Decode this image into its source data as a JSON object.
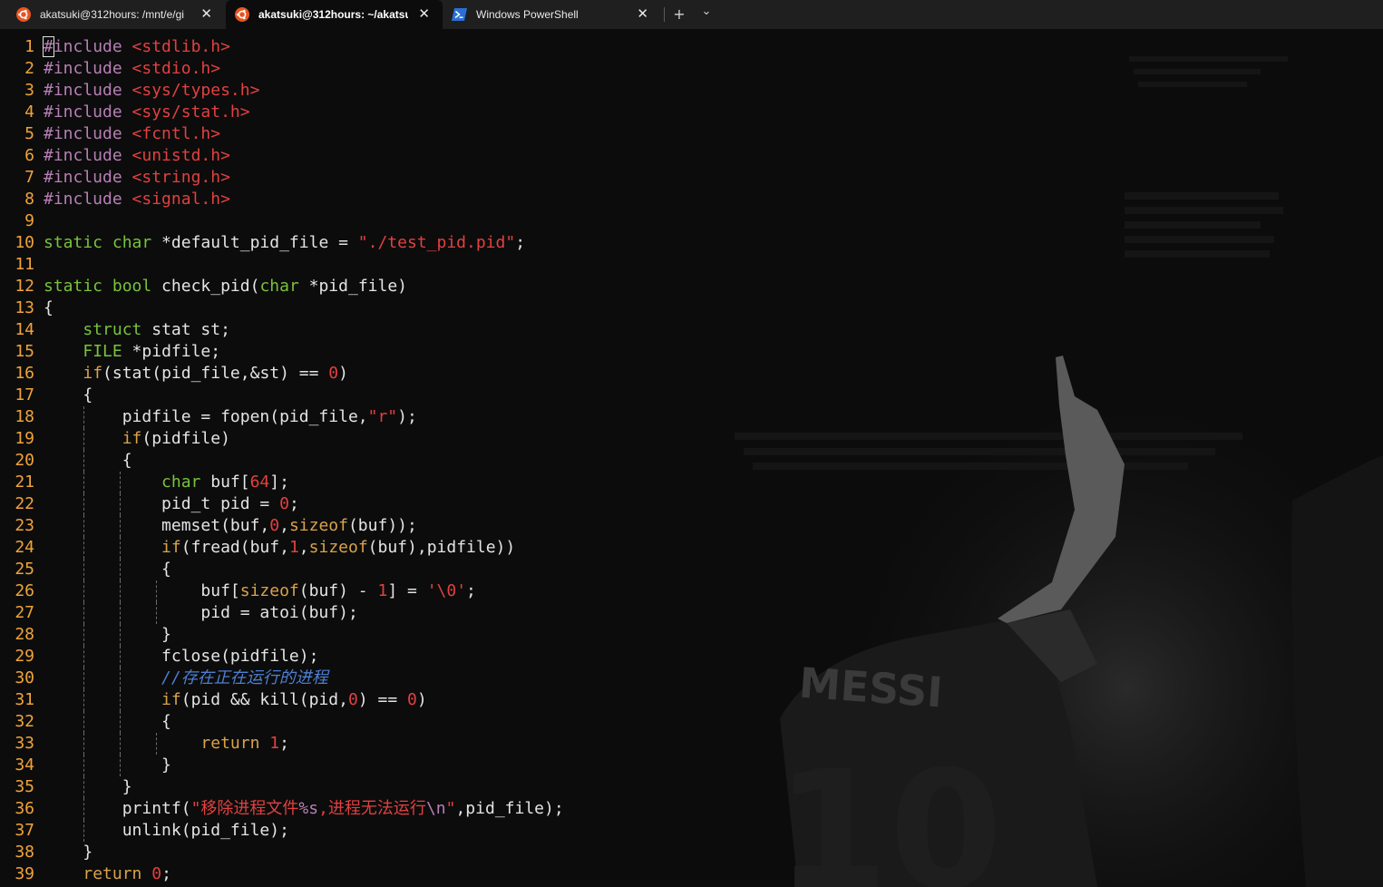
{
  "tabs": [
    {
      "label": "akatsuki@312hours: /mnt/e/gi",
      "icon": "ubuntu-icon",
      "active": false
    },
    {
      "label": "akatsuki@312hours: ~/akatsu",
      "icon": "ubuntu-icon",
      "active": true
    },
    {
      "label": "Windows PowerShell",
      "icon": "powershell-icon",
      "active": false
    }
  ],
  "tabbar": {
    "close_glyph": "✕",
    "new_tab_glyph": "+",
    "dropdown_glyph": "⌄"
  },
  "background": {
    "jersey_name": "MESSI",
    "jersey_number": "10"
  },
  "colors": {
    "keyword": "#d9a34a",
    "type": "#79c23c",
    "preprocessor": "#b77fb5",
    "string": "#e24040",
    "comment": "#4d7fd1",
    "line_number": "#f0a33a"
  },
  "editor": {
    "lines": [
      {
        "n": "1",
        "tokens": [
          [
            "pp",
            "#include "
          ],
          [
            "str",
            "<stdlib.h>"
          ]
        ]
      },
      {
        "n": "2",
        "tokens": [
          [
            "pp",
            "#include "
          ],
          [
            "str",
            "<stdio.h>"
          ]
        ]
      },
      {
        "n": "3",
        "tokens": [
          [
            "pp",
            "#include "
          ],
          [
            "str",
            "<sys/types.h>"
          ]
        ]
      },
      {
        "n": "4",
        "tokens": [
          [
            "pp",
            "#include "
          ],
          [
            "str",
            "<sys/stat.h>"
          ]
        ]
      },
      {
        "n": "5",
        "tokens": [
          [
            "pp",
            "#include "
          ],
          [
            "str",
            "<fcntl.h>"
          ]
        ]
      },
      {
        "n": "6",
        "tokens": [
          [
            "pp",
            "#include "
          ],
          [
            "str",
            "<unistd.h>"
          ]
        ]
      },
      {
        "n": "7",
        "tokens": [
          [
            "pp",
            "#include "
          ],
          [
            "str",
            "<string.h>"
          ]
        ]
      },
      {
        "n": "8",
        "tokens": [
          [
            "pp",
            "#include "
          ],
          [
            "str",
            "<signal.h>"
          ]
        ]
      },
      {
        "n": "9",
        "tokens": []
      },
      {
        "n": "10",
        "tokens": [
          [
            "ty",
            "static char"
          ],
          [
            "",
            " *default_pid_file = "
          ],
          [
            "str",
            "\"./test_pid.pid\""
          ],
          [
            "",
            ";"
          ]
        ]
      },
      {
        "n": "11",
        "tokens": []
      },
      {
        "n": "12",
        "tokens": [
          [
            "ty",
            "static bool"
          ],
          [
            "",
            " check_pid("
          ],
          [
            "ty",
            "char"
          ],
          [
            "",
            " *pid_file)"
          ]
        ]
      },
      {
        "n": "13",
        "tokens": [
          [
            "",
            "{"
          ]
        ]
      },
      {
        "n": "14",
        "tokens": [
          [
            "",
            "    "
          ],
          [
            "ty",
            "struct"
          ],
          [
            "",
            " stat st;"
          ]
        ]
      },
      {
        "n": "15",
        "tokens": [
          [
            "",
            "    "
          ],
          [
            "ty",
            "FILE"
          ],
          [
            "",
            " *pidfile;"
          ]
        ]
      },
      {
        "n": "16",
        "tokens": [
          [
            "",
            "    "
          ],
          [
            "kw",
            "if"
          ],
          [
            "",
            "(stat(pid_file,&st) == "
          ],
          [
            "num",
            "0"
          ],
          [
            "",
            ")"
          ]
        ]
      },
      {
        "n": "17",
        "tokens": [
          [
            "",
            "    {"
          ]
        ]
      },
      {
        "n": "18",
        "tokens": [
          [
            "",
            "        pidfile = fopen(pid_file,"
          ],
          [
            "str",
            "\"r\""
          ],
          [
            "",
            ");"
          ]
        ]
      },
      {
        "n": "19",
        "tokens": [
          [
            "",
            "        "
          ],
          [
            "kw",
            "if"
          ],
          [
            "",
            "(pidfile)"
          ]
        ]
      },
      {
        "n": "20",
        "tokens": [
          [
            "",
            "        {"
          ]
        ]
      },
      {
        "n": "21",
        "tokens": [
          [
            "",
            "            "
          ],
          [
            "ty",
            "char"
          ],
          [
            "",
            " buf["
          ],
          [
            "num",
            "64"
          ],
          [
            "",
            "];"
          ]
        ]
      },
      {
        "n": "22",
        "tokens": [
          [
            "",
            "            pid_t pid = "
          ],
          [
            "num",
            "0"
          ],
          [
            "",
            ";"
          ]
        ]
      },
      {
        "n": "23",
        "tokens": [
          [
            "",
            "            memset(buf,"
          ],
          [
            "num",
            "0"
          ],
          [
            "",
            ","
          ],
          [
            "kw",
            "sizeof"
          ],
          [
            "",
            "(buf));"
          ]
        ]
      },
      {
        "n": "24",
        "tokens": [
          [
            "",
            "            "
          ],
          [
            "kw",
            "if"
          ],
          [
            "",
            "(fread(buf,"
          ],
          [
            "num",
            "1"
          ],
          [
            "",
            ","
          ],
          [
            "kw",
            "sizeof"
          ],
          [
            "",
            "(buf),pidfile))"
          ]
        ]
      },
      {
        "n": "25",
        "tokens": [
          [
            "",
            "            {"
          ]
        ]
      },
      {
        "n": "26",
        "tokens": [
          [
            "",
            "                buf["
          ],
          [
            "kw",
            "sizeof"
          ],
          [
            "",
            "(buf) - "
          ],
          [
            "num",
            "1"
          ],
          [
            "",
            "] = "
          ],
          [
            "str",
            "'\\0'"
          ],
          [
            "",
            ";"
          ]
        ]
      },
      {
        "n": "27",
        "tokens": [
          [
            "",
            "                pid = atoi(buf);"
          ]
        ]
      },
      {
        "n": "28",
        "tokens": [
          [
            "",
            "            }"
          ]
        ]
      },
      {
        "n": "29",
        "tokens": [
          [
            "",
            "            fclose(pidfile);"
          ]
        ]
      },
      {
        "n": "30",
        "tokens": [
          [
            "",
            "            "
          ],
          [
            "cm",
            "//存在正在运行的进程"
          ]
        ]
      },
      {
        "n": "31",
        "tokens": [
          [
            "",
            "            "
          ],
          [
            "kw",
            "if"
          ],
          [
            "",
            "(pid && kill(pid,"
          ],
          [
            "num",
            "0"
          ],
          [
            "",
            ") == "
          ],
          [
            "num",
            "0"
          ],
          [
            "",
            ")"
          ]
        ]
      },
      {
        "n": "32",
        "tokens": [
          [
            "",
            "            {"
          ]
        ]
      },
      {
        "n": "33",
        "tokens": [
          [
            "",
            "                "
          ],
          [
            "kw",
            "return"
          ],
          [
            "",
            " "
          ],
          [
            "num",
            "1"
          ],
          [
            "",
            ";"
          ]
        ]
      },
      {
        "n": "34",
        "tokens": [
          [
            "",
            "            }"
          ]
        ]
      },
      {
        "n": "35",
        "tokens": [
          [
            "",
            "        }"
          ]
        ]
      },
      {
        "n": "36",
        "tokens": [
          [
            "",
            "        printf("
          ],
          [
            "str",
            "\"移除进程文件"
          ],
          [
            "pp",
            "%s"
          ],
          [
            "str",
            ",进程无法运行"
          ],
          [
            "pp",
            "\\n"
          ],
          [
            "str",
            "\""
          ],
          [
            "",
            ",pid_file);"
          ]
        ]
      },
      {
        "n": "37",
        "tokens": [
          [
            "",
            "        unlink(pid_file);"
          ]
        ]
      },
      {
        "n": "38",
        "tokens": [
          [
            "",
            "    }"
          ]
        ]
      },
      {
        "n": "39",
        "tokens": [
          [
            "",
            "    "
          ],
          [
            "kw",
            "return"
          ],
          [
            "",
            " "
          ],
          [
            "num",
            "0"
          ],
          [
            "",
            ";"
          ]
        ]
      }
    ]
  }
}
